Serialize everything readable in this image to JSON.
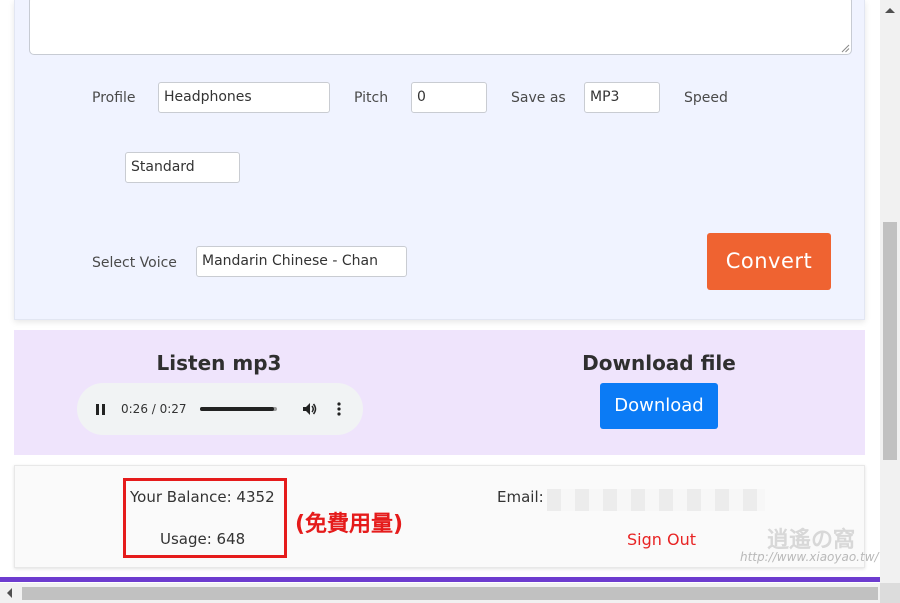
{
  "form": {
    "profile_label": "Profile",
    "profile_value": "Headphones",
    "pitch_label": "Pitch",
    "pitch_value": "0",
    "saveas_label": "Save as",
    "saveas_value": "MP3",
    "speed_label": "Speed",
    "speed_value": "Standard",
    "voice_label": "Select Voice",
    "voice_value": "Mandarin Chinese - Chan",
    "convert_label": "Convert"
  },
  "result": {
    "listen_heading": "Listen mp3",
    "player_time": "0:26 / 0:27",
    "player_progress": 0.96,
    "download_heading": "Download file",
    "download_label": "Download"
  },
  "account": {
    "balance_text": "Your Balance: 4352",
    "usage_text": "Usage: 648",
    "annotation": "(免費用量)",
    "email_label": "Email:",
    "signout_label": "Sign Out",
    "watermark_text": "http://www.xiaoyao.tw/"
  },
  "colors": {
    "convert": "#ef6331",
    "download": "#0b7bf5",
    "annotation": "#e51b1b",
    "accent_line": "#6d3ccf"
  }
}
